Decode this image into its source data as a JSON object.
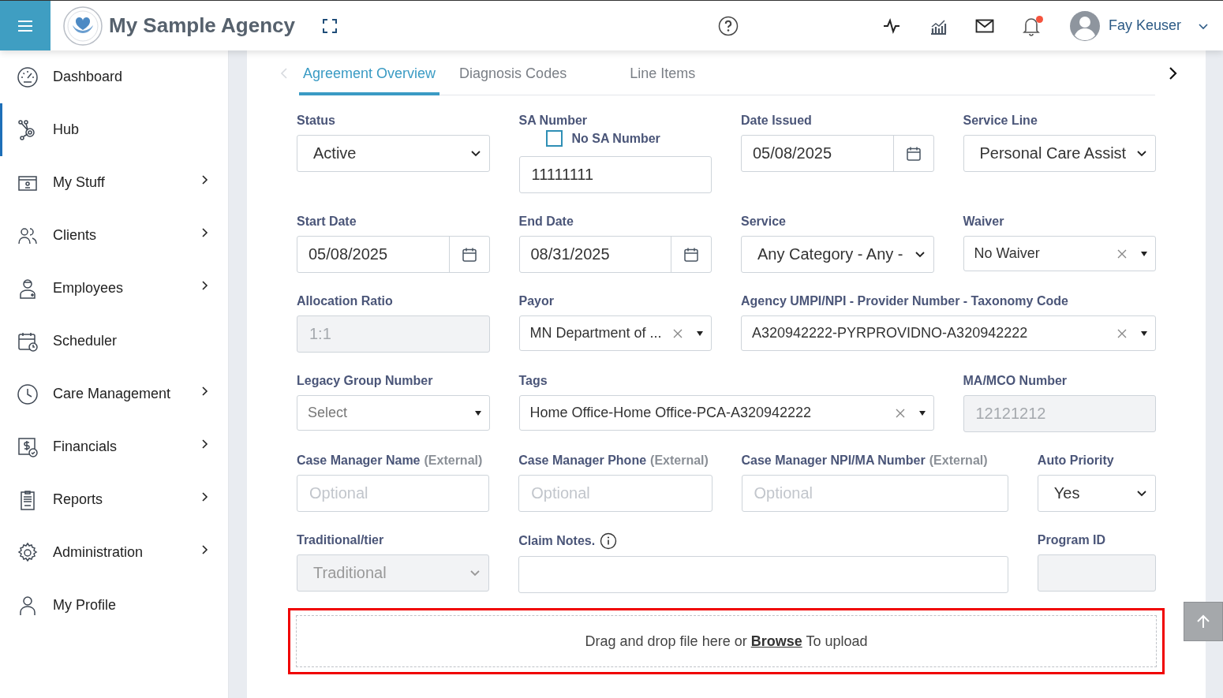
{
  "header": {
    "app_name": "My Sample Agency",
    "user_name": "Fay Keuser",
    "notifications_unread": true
  },
  "sidebar": {
    "items": [
      {
        "label": "Dashboard",
        "selected": false,
        "has_submenu": false
      },
      {
        "label": "Hub",
        "selected": true,
        "has_submenu": false
      },
      {
        "label": "My Stuff",
        "selected": false,
        "has_submenu": true
      },
      {
        "label": "Clients",
        "selected": false,
        "has_submenu": true
      },
      {
        "label": "Employees",
        "selected": false,
        "has_submenu": true
      },
      {
        "label": "Scheduler",
        "selected": false,
        "has_submenu": false
      },
      {
        "label": "Care Management",
        "selected": false,
        "has_submenu": true
      },
      {
        "label": "Financials",
        "selected": false,
        "has_submenu": true
      },
      {
        "label": "Reports",
        "selected": false,
        "has_submenu": true
      },
      {
        "label": "Administration",
        "selected": false,
        "has_submenu": true
      },
      {
        "label": "My Profile",
        "selected": false,
        "has_submenu": false
      }
    ]
  },
  "tabs": [
    {
      "label": "Agreement Overview",
      "selected": true
    },
    {
      "label": "Diagnosis Codes",
      "selected": false
    },
    {
      "label": "Line Items",
      "selected": false
    }
  ],
  "form": {
    "rows": [
      {
        "fields": [
          {
            "kind": "select",
            "label": "Status",
            "value": "Active",
            "disabled": false
          },
          {
            "kind": "text",
            "label": "SA Number",
            "value": "11111111",
            "disabled": false,
            "checkbox": {
              "label": "No SA Number",
              "checked": false
            }
          },
          {
            "kind": "date",
            "label": "Date Issued",
            "value": "05/08/2025",
            "disabled": false
          },
          {
            "kind": "select",
            "label": "Service Line",
            "value": "Personal Care Assist",
            "disabled": false
          }
        ]
      },
      {
        "fields": [
          {
            "kind": "date",
            "label": "Start Date",
            "value": "05/08/2025",
            "disabled": false
          },
          {
            "kind": "date",
            "label": "End Date",
            "value": "08/31/2025",
            "disabled": false
          },
          {
            "kind": "select",
            "label": "Service",
            "value": "Any Category - Any -",
            "disabled": false
          },
          {
            "kind": "combo",
            "label": "Waiver",
            "value": "No Waiver",
            "clearable": true,
            "disabled": false
          }
        ]
      },
      {
        "fields": [
          {
            "kind": "text",
            "label": "Allocation Ratio",
            "value": "1:1",
            "disabled": true
          },
          {
            "kind": "combo",
            "label": "Payor",
            "value": "MN Department of ...",
            "clearable": true,
            "disabled": false
          },
          {
            "kind": "combo",
            "label": "Agency UMPI/NPI - Provider Number - Taxonomy Code",
            "value": "A320942222-PYRPROVIDNO-A320942222",
            "clearable": true,
            "disabled": false
          }
        ]
      },
      {
        "fields": [
          {
            "kind": "combo",
            "label": "Legacy Group Number",
            "placeholder": "Select",
            "clearable": false,
            "disabled": false
          },
          {
            "kind": "combo",
            "label": "Tags",
            "value": "Home Office-Home Office-PCA-A320942222",
            "clearable": true,
            "disabled": false
          },
          {
            "kind": "text",
            "label": "MA/MCO Number",
            "value": "12121212",
            "disabled": true
          }
        ]
      },
      {
        "fields": [
          {
            "kind": "text",
            "label": "Case Manager Name",
            "note": "(External)",
            "placeholder": "Optional",
            "disabled": false
          },
          {
            "kind": "text",
            "label": "Case Manager Phone",
            "note": "(External)",
            "placeholder": "Optional",
            "disabled": false
          },
          {
            "kind": "text",
            "label": "Case Manager NPI/MA Number",
            "note": "(External)",
            "placeholder": "Optional",
            "disabled": false
          },
          {
            "kind": "select",
            "label": "Auto Priority",
            "value": "Yes",
            "disabled": false
          }
        ]
      },
      {
        "fields": [
          {
            "kind": "select",
            "label": "Traditional/tier",
            "value": "Traditional",
            "disabled": true
          },
          {
            "kind": "text",
            "label": "Claim Notes.",
            "info": true,
            "disabled": false
          },
          {
            "kind": "text",
            "label": "Program ID",
            "disabled": true
          }
        ]
      }
    ]
  },
  "upload": {
    "text_before": "Drag and drop file here or",
    "link": "Browse",
    "text_after": "To upload"
  }
}
